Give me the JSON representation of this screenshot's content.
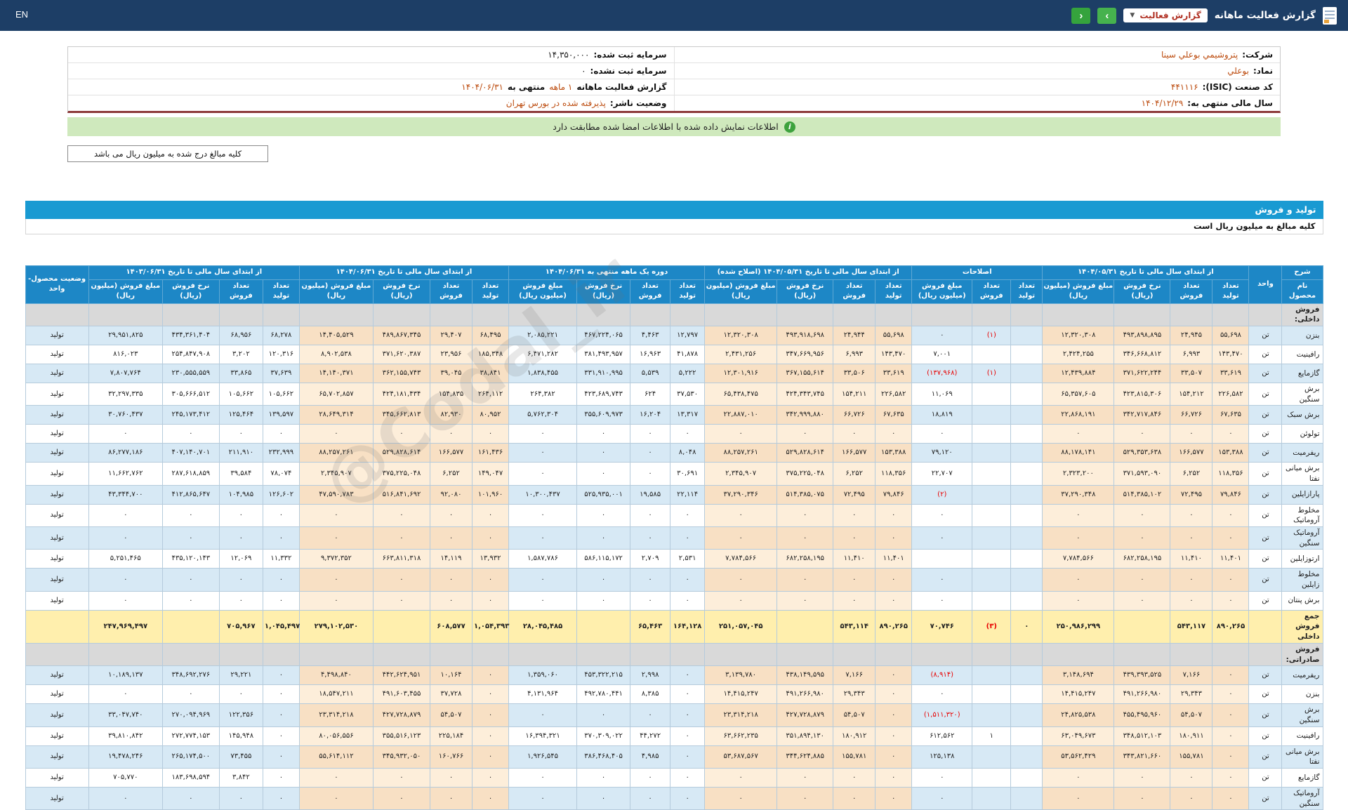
{
  "topbar": {
    "en": "EN",
    "title": "گزارش فعالیت ماهانه",
    "dropdown": "گزارش فعالیت",
    "caret": "▼",
    "next": "›",
    "prev": "‹"
  },
  "info": {
    "right": [
      {
        "label": "شرکت:",
        "value": "پتروشيمي بوعلي سينا"
      },
      {
        "label": "نماد:",
        "value": "بوعلي"
      },
      {
        "label": "کد صنعت (ISIC):",
        "value": "۴۴۱۱۱۶"
      },
      {
        "label": "سال مالی منتهی به:",
        "value": "۱۴۰۴/۱۲/۲۹"
      }
    ],
    "left": [
      {
        "label": "سرمایه ثبت شده:",
        "value": "۱۴,۳۵۰,۰۰۰"
      },
      {
        "label": "سرمایه ثبت نشده:",
        "value": "۰"
      },
      {
        "label": "گزارش فعالیت ماهانه",
        "mid": "۱ ماهه",
        "tail": "منتهی به",
        "value": "۱۴۰۴/۰۶/۳۱"
      },
      {
        "label": "وضعیت ناشر:",
        "value": "پذیرفته شده در بورس تهران"
      }
    ]
  },
  "banner": {
    "icon": "i",
    "text": "اطلاعات نمایش داده شده با اطلاعات امضا شده مطابقت دارد"
  },
  "note_box": "کلیه مبالغ درج شده به میلیون ریال می باشد",
  "section": {
    "title": "تولید و فروش",
    "subtitle": "کلیه مبالغ به میلیون ریال است"
  },
  "watermark": "@Codal_ir",
  "table": {
    "headers": {
      "desc": "شرح",
      "product": "نام محصول",
      "unit": "واحد",
      "status": "وضعیت محصول-واحد"
    },
    "groups": [
      {
        "key": "g1",
        "cream": true,
        "label": "از ابتدای سال مالی تا تاریخ ۱۴۰۴/۰۵/۳۱",
        "cols": [
          "تعداد تولید",
          "تعداد فروش",
          "نرخ فروش (ریال)",
          "مبلغ فروش (میلیون ریال)"
        ]
      },
      {
        "key": "g2",
        "cream": false,
        "label": "اصلاحات",
        "cols": [
          "تعداد تولید",
          "تعداد فروش",
          "مبلغ فروش (میلیون ریال)"
        ]
      },
      {
        "key": "g3",
        "cream": true,
        "label": "از ابتدای سال مالی تا تاریخ ۱۴۰۴/۰۵/۳۱ (اصلاح شده)",
        "cols": [
          "تعداد تولید",
          "تعداد فروش",
          "نرخ فروش (ریال)",
          "مبلغ فروش (میلیون ریال)"
        ]
      },
      {
        "key": "g4",
        "cream": false,
        "label": "دوره یک ماهه منتهی به ۱۴۰۴/۰۶/۳۱",
        "cols": [
          "تعداد تولید",
          "تعداد فروش",
          "نرخ فروش (ریال)",
          "مبلغ فروش (میلیون ریال)"
        ]
      },
      {
        "key": "g5",
        "cream": true,
        "label": "از ابتدای سال مالی تا تاریخ ۱۴۰۴/۰۶/۳۱",
        "cols": [
          "تعداد تولید",
          "تعداد فروش",
          "نرخ فروش (ریال)",
          "مبلغ فروش (میلیون ریال)"
        ]
      },
      {
        "key": "g6",
        "cream": false,
        "label": "از ابتدای سال مالی تا تاریخ ۱۴۰۳/۰۶/۳۱",
        "cols": [
          "تعداد تولید",
          "تعداد فروش",
          "نرخ فروش (ریال)",
          "مبلغ فروش (میلیون ریال)"
        ]
      }
    ],
    "rows": [
      {
        "type": "section",
        "name": "فروش داخلی:"
      },
      {
        "type": "data",
        "name": "بنزن",
        "unit": "تن",
        "status": "تولید",
        "g1": [
          "۵۵,۶۹۸",
          "۲۴,۹۴۵",
          "۴۹۳,۸۹۸,۸۹۵",
          "۱۲,۳۲۰,۳۰۸"
        ],
        "g2": [
          "",
          "(۱)",
          "۰"
        ],
        "g3": [
          "۵۵,۶۹۸",
          "۲۴,۹۴۴",
          "۴۹۳,۹۱۸,۶۹۸",
          "۱۲,۳۲۰,۳۰۸"
        ],
        "g4": [
          "۱۲,۷۹۷",
          "۴,۴۶۳",
          "۴۶۷,۲۲۴,۰۶۵",
          "۲,۰۸۵,۲۲۱"
        ],
        "g5": [
          "۶۸,۴۹۵",
          "۲۹,۴۰۷",
          "۴۸۹,۸۶۷,۳۴۵",
          "۱۴,۴۰۵,۵۲۹"
        ],
        "g6": [
          "۶۸,۲۷۸",
          "۶۸,۹۵۶",
          "۴۳۴,۳۶۱,۴۰۴",
          "۲۹,۹۵۱,۸۲۵"
        ]
      },
      {
        "type": "data",
        "name": "رافینیت",
        "unit": "تن",
        "status": "تولید",
        "g1": [
          "۱۴۳,۴۷۰",
          "۶,۹۹۳",
          "۳۴۶,۶۶۸,۸۱۲",
          "۲,۴۲۴,۲۵۵"
        ],
        "g2": [
          "",
          "",
          "۷,۰۰۱"
        ],
        "g3": [
          "۱۴۳,۴۷۰",
          "۶,۹۹۳",
          "۳۴۷,۶۶۹,۹۵۶",
          "۲,۴۳۱,۲۵۶"
        ],
        "g4": [
          "۴۱,۸۷۸",
          "۱۶,۹۶۳",
          "۳۸۱,۴۹۳,۹۵۷",
          "۶,۴۷۱,۲۸۲"
        ],
        "g5": [
          "۱۸۵,۳۴۸",
          "۲۳,۹۵۶",
          "۳۷۱,۶۲۰,۳۸۷",
          "۸,۹۰۲,۵۳۸"
        ],
        "g6": [
          "۱۲۰,۳۱۶",
          "۳,۲۰۲",
          "۲۵۴,۸۴۷,۹۰۸",
          "۸۱۶,۰۲۳"
        ]
      },
      {
        "type": "data",
        "name": "گازمایع",
        "unit": "تن",
        "status": "تولید",
        "g1": [
          "۳۳,۶۱۹",
          "۳۳,۵۰۷",
          "۳۷۱,۶۲۲,۲۴۴",
          "۱۲,۴۳۹,۸۸۴"
        ],
        "g2": [
          "",
          "(۱)",
          "(۱۳۷,۹۶۸)"
        ],
        "g3": [
          "۳۳,۶۱۹",
          "۳۳,۵۰۶",
          "۳۶۷,۱۵۵,۶۱۴",
          "۱۲,۳۰۱,۹۱۶"
        ],
        "g4": [
          "۵,۲۲۲",
          "۵,۵۳۹",
          "۳۳۱,۹۱۰,۹۹۵",
          "۱,۸۳۸,۴۵۵"
        ],
        "g5": [
          "۳۸,۸۴۱",
          "۳۹,۰۴۵",
          "۳۶۲,۱۵۵,۷۴۳",
          "۱۴,۱۴۰,۳۷۱"
        ],
        "g6": [
          "۳۷,۶۳۹",
          "۳۳,۸۶۵",
          "۲۳۰,۵۵۵,۵۵۹",
          "۷,۸۰۷,۷۶۴"
        ]
      },
      {
        "type": "data",
        "name": "برش سنگین",
        "unit": "تن",
        "status": "تولید",
        "g1": [
          "۲۲۶,۵۸۲",
          "۱۵۴,۲۱۲",
          "۴۲۳,۸۱۵,۳۰۶",
          "۶۵,۳۵۷,۶۰۵"
        ],
        "g2": [
          "",
          "",
          "۱۱,۰۶۹"
        ],
        "g3": [
          "۲۲۶,۵۸۲",
          "۱۵۴,۲۱۱",
          "۴۲۴,۳۴۳,۷۴۵",
          "۶۵,۴۳۸,۴۷۵"
        ],
        "g4": [
          "۳۷,۵۳۰",
          "۶۲۴",
          "۴۲۳,۶۸۹,۷۴۳",
          "۲۶۴,۳۸۲"
        ],
        "g5": [
          "۲۶۴,۱۱۲",
          "۱۵۴,۸۳۵",
          "۴۲۴,۱۸۱,۴۳۴",
          "۶۵,۷۰۲,۸۵۷"
        ],
        "g6": [
          "۱۰۵,۶۶۲",
          "۱۰۵,۶۶۲",
          "۳۰۵,۶۶۶,۵۱۲",
          "۳۲,۲۹۷,۳۳۵"
        ]
      },
      {
        "type": "data",
        "name": "برش سبک",
        "unit": "تن",
        "status": "تولید",
        "g1": [
          "۶۷,۶۳۵",
          "۶۶,۷۲۶",
          "۳۴۲,۷۱۷,۸۴۶",
          "۲۲,۸۶۸,۱۹۱"
        ],
        "g2": [
          "",
          "",
          "۱۸,۸۱۹"
        ],
        "g3": [
          "۶۷,۶۳۵",
          "۶۶,۷۲۶",
          "۳۴۲,۹۹۹,۸۸۰",
          "۲۲,۸۸۷,۰۱۰"
        ],
        "g4": [
          "۱۳,۳۱۷",
          "۱۶,۲۰۴",
          "۳۵۵,۶۰۹,۹۷۳",
          "۵,۷۶۲,۳۰۴"
        ],
        "g5": [
          "۸۰,۹۵۲",
          "۸۲,۹۳۰",
          "۳۴۵,۶۶۲,۸۱۳",
          "۲۸,۶۴۹,۳۱۴"
        ],
        "g6": [
          "۱۳۹,۵۹۷",
          "۱۲۵,۴۶۴",
          "۲۴۵,۱۷۳,۴۱۲",
          "۳۰,۷۶۰,۴۳۷"
        ]
      },
      {
        "type": "data",
        "name": "تولوئن",
        "unit": "تن",
        "status": "تولید",
        "g1": [
          "۰",
          "۰",
          "۰",
          "۰"
        ],
        "g2": [
          "",
          "",
          "۰"
        ],
        "g3": [
          "۰",
          "۰",
          "۰",
          "۰"
        ],
        "g4": [
          "۰",
          "۰",
          "۰",
          "۰"
        ],
        "g5": [
          "۰",
          "۰",
          "۰",
          "۰"
        ],
        "g6": [
          "۰",
          "۰",
          "۰",
          "۰"
        ]
      },
      {
        "type": "data",
        "name": "ریفرمیت",
        "unit": "تن",
        "status": "تولید",
        "g1": [
          "۱۵۳,۳۸۸",
          "۱۶۶,۵۷۷",
          "۵۲۹,۳۵۳,۶۳۸",
          "۸۸,۱۷۸,۱۴۱"
        ],
        "g2": [
          "",
          "",
          "۷۹,۱۲۰"
        ],
        "g3": [
          "۱۵۳,۳۸۸",
          "۱۶۶,۵۷۷",
          "۵۲۹,۸۲۸,۶۱۴",
          "۸۸,۲۵۷,۲۶۱"
        ],
        "g4": [
          "۸,۰۴۸",
          "۰",
          "۰",
          "۰"
        ],
        "g5": [
          "۱۶۱,۴۳۶",
          "۱۶۶,۵۷۷",
          "۵۲۹,۸۲۸,۶۱۴",
          "۸۸,۲۵۷,۲۶۱"
        ],
        "g6": [
          "۲۳۲,۹۹۹",
          "۲۱۱,۹۱۰",
          "۴۰۷,۱۴۰,۷۰۱",
          "۸۶,۲۷۷,۱۸۶"
        ]
      },
      {
        "type": "data",
        "name": "برش میانی نفتا",
        "unit": "تن",
        "status": "تولید",
        "g1": [
          "۱۱۸,۳۵۶",
          "۶,۲۵۲",
          "۳۷۱,۵۹۳,۰۹۰",
          "۲,۳۲۳,۲۰۰"
        ],
        "g2": [
          "",
          "",
          "۲۲,۷۰۷"
        ],
        "g3": [
          "۱۱۸,۳۵۶",
          "۶,۲۵۲",
          "۳۷۵,۲۲۵,۰۴۸",
          "۲,۳۴۵,۹۰۷"
        ],
        "g4": [
          "۳۰,۶۹۱",
          "۰",
          "۰",
          "۰"
        ],
        "g5": [
          "۱۴۹,۰۴۷",
          "۶,۲۵۲",
          "۳۷۵,۲۲۵,۰۴۸",
          "۲,۳۴۵,۹۰۷"
        ],
        "g6": [
          "۷۸,۰۷۴",
          "۳۹,۵۸۴",
          "۲۸۷,۶۱۸,۸۵۹",
          "۱۱,۶۶۲,۷۶۲"
        ]
      },
      {
        "type": "data",
        "name": "پارازایلین",
        "unit": "تن",
        "status": "تولید",
        "g1": [
          "۷۹,۸۴۶",
          "۷۲,۴۹۵",
          "۵۱۴,۳۸۵,۱۰۲",
          "۳۷,۲۹۰,۳۴۸"
        ],
        "g2": [
          "",
          "",
          "(۲)"
        ],
        "g3": [
          "۷۹,۸۴۶",
          "۷۲,۴۹۵",
          "۵۱۴,۳۸۵,۰۷۵",
          "۳۷,۲۹۰,۳۴۶"
        ],
        "g4": [
          "۲۲,۱۱۴",
          "۱۹,۵۸۵",
          "۵۲۵,۹۳۵,۰۰۱",
          "۱۰,۳۰۰,۴۳۷"
        ],
        "g5": [
          "۱۰۱,۹۶۰",
          "۹۲,۰۸۰",
          "۵۱۶,۸۴۱,۶۹۲",
          "۴۷,۵۹۰,۷۸۳"
        ],
        "g6": [
          "۱۲۶,۶۰۲",
          "۱۰۴,۹۸۵",
          "۴۱۲,۸۶۵,۶۴۷",
          "۴۳,۳۴۴,۷۰۰"
        ]
      },
      {
        "type": "data",
        "name": "مخلوط آروماتیک",
        "unit": "تن",
        "status": "تولید",
        "g1": [
          "۰",
          "۰",
          "۰",
          "۰"
        ],
        "g2": [
          "",
          "",
          "۰"
        ],
        "g3": [
          "۰",
          "۰",
          "۰",
          "۰"
        ],
        "g4": [
          "۰",
          "۰",
          "۰",
          "۰"
        ],
        "g5": [
          "۰",
          "۰",
          "۰",
          "۰"
        ],
        "g6": [
          "۰",
          "۰",
          "۰",
          "۰"
        ]
      },
      {
        "type": "data",
        "name": "آروماتیک سنگین",
        "unit": "تن",
        "status": "تولید",
        "g1": [
          "۰",
          "۰",
          "۰",
          "۰"
        ],
        "g2": [
          "",
          "",
          "۰"
        ],
        "g3": [
          "۰",
          "۰",
          "۰",
          "۰"
        ],
        "g4": [
          "۰",
          "۰",
          "۰",
          "۰"
        ],
        "g5": [
          "۰",
          "۰",
          "۰",
          "۰"
        ],
        "g6": [
          "۰",
          "۰",
          "۰",
          "۰"
        ]
      },
      {
        "type": "data",
        "name": "ارتوزایلین",
        "unit": "تن",
        "status": "تولید",
        "g1": [
          "۱۱,۴۰۱",
          "۱۱,۴۱۰",
          "۶۸۲,۲۵۸,۱۹۵",
          "۷,۷۸۴,۵۶۶"
        ],
        "g2": [
          "",
          "",
          ""
        ],
        "g3": [
          "۱۱,۴۰۱",
          "۱۱,۴۱۰",
          "۶۸۲,۲۵۸,۱۹۵",
          "۷,۷۸۴,۵۶۶"
        ],
        "g4": [
          "۲,۵۳۱",
          "۲,۷۰۹",
          "۵۸۶,۱۱۵,۱۷۲",
          "۱,۵۸۷,۷۸۶"
        ],
        "g5": [
          "۱۳,۹۳۲",
          "۱۴,۱۱۹",
          "۶۶۳,۸۱۱,۳۱۸",
          "۹,۳۷۲,۳۵۲"
        ],
        "g6": [
          "۱۱,۳۳۲",
          "۱۲,۰۶۹",
          "۴۳۵,۱۲۰,۱۴۳",
          "۵,۲۵۱,۴۶۵"
        ]
      },
      {
        "type": "data",
        "name": "مخلوط زایلین",
        "unit": "تن",
        "status": "تولید",
        "g1": [
          "۰",
          "۰",
          "۰",
          "۰"
        ],
        "g2": [
          "",
          "",
          "۰"
        ],
        "g3": [
          "۰",
          "۰",
          "۰",
          "۰"
        ],
        "g4": [
          "۰",
          "۰",
          "۰",
          "۰"
        ],
        "g5": [
          "۰",
          "۰",
          "۰",
          "۰"
        ],
        "g6": [
          "۰",
          "۰",
          "۰",
          "۰"
        ]
      },
      {
        "type": "data",
        "name": "برش پنتان",
        "unit": "تن",
        "status": "تولید",
        "g1": [
          "۰",
          "۰",
          "۰",
          "۰"
        ],
        "g2": [
          "",
          "",
          "۰"
        ],
        "g3": [
          "۰",
          "۰",
          "۰",
          "۰"
        ],
        "g4": [
          "۰",
          "۰",
          "۰",
          "۰"
        ],
        "g5": [
          "۰",
          "۰",
          "۰",
          "۰"
        ],
        "g6": [
          "۰",
          "۰",
          "۰",
          "۰"
        ]
      },
      {
        "type": "total",
        "name": "جمع فروش داخلی",
        "unit": "",
        "status": "",
        "g1": [
          "۸۹۰,۲۶۵",
          "۵۴۳,۱۱۷",
          "",
          "۲۵۰,۹۸۶,۲۹۹"
        ],
        "g2": [
          "۰",
          "(۳)",
          "۷۰,۷۴۶"
        ],
        "g3": [
          "۸۹۰,۲۶۵",
          "۵۴۳,۱۱۴",
          "",
          "۲۵۱,۰۵۷,۰۴۵"
        ],
        "g4": [
          "۱۶۴,۱۲۸",
          "۶۵,۴۶۳",
          "",
          "۲۸,۰۴۵,۴۸۵"
        ],
        "g5": [
          "۱,۰۵۴,۳۹۳",
          "۶۰۸,۵۷۷",
          "",
          "۲۷۹,۱۰۲,۵۳۰"
        ],
        "g6": [
          "۱,۰۴۵,۴۹۷",
          "۷۰۵,۹۶۷",
          "",
          "۲۴۷,۹۶۹,۴۹۷"
        ]
      },
      {
        "type": "section",
        "name": "فروش صادراتی:"
      },
      {
        "type": "data",
        "name": "ریفرمیت",
        "unit": "تن",
        "status": "تولید",
        "g1": [
          "۰",
          "۷,۱۶۶",
          "۴۳۹,۳۹۳,۵۲۵",
          "۳,۱۴۸,۶۹۴"
        ],
        "g2": [
          "",
          "",
          "(۸,۹۱۴)"
        ],
        "g3": [
          "۰",
          "۷,۱۶۶",
          "۴۳۸,۱۴۹,۵۹۵",
          "۳,۱۳۹,۷۸۰"
        ],
        "g4": [
          "۰",
          "۲,۹۹۸",
          "۴۵۳,۳۲۲,۲۱۵",
          "۱,۳۵۹,۰۶۰"
        ],
        "g5": [
          "۰",
          "۱۰,۱۶۴",
          "۴۴۲,۶۲۴,۹۵۱",
          "۴,۴۹۸,۸۴۰"
        ],
        "g6": [
          "۰",
          "۲۹,۲۲۱",
          "۳۴۸,۶۹۲,۲۷۶",
          "۱۰,۱۸۹,۱۳۷"
        ]
      },
      {
        "type": "data",
        "name": "بنزن",
        "unit": "تن",
        "status": "تولید",
        "g1": [
          "۰",
          "۲۹,۳۴۳",
          "۴۹۱,۲۶۶,۹۸۰",
          "۱۴,۴۱۵,۲۴۷"
        ],
        "g2": [
          "",
          "",
          "۰"
        ],
        "g3": [
          "۰",
          "۲۹,۳۴۳",
          "۴۹۱,۲۶۶,۹۸۰",
          "۱۴,۴۱۵,۲۴۷"
        ],
        "g4": [
          "۰",
          "۸,۳۸۵",
          "۴۹۲,۷۸۰,۴۴۱",
          "۴,۱۳۱,۹۶۴"
        ],
        "g5": [
          "۰",
          "۳۷,۷۲۸",
          "۴۹۱,۶۰۳,۴۵۵",
          "۱۸,۵۴۷,۲۱۱"
        ],
        "g6": [
          "۰",
          "۰",
          "۰",
          "۰"
        ]
      },
      {
        "type": "data",
        "name": "برش سنگین",
        "unit": "تن",
        "status": "تولید",
        "g1": [
          "۰",
          "۵۴,۵۰۷",
          "۴۵۵,۴۹۵,۹۶۰",
          "۲۴,۸۲۵,۵۳۸"
        ],
        "g2": [
          "",
          "",
          "(۱,۵۱۱,۳۲۰)"
        ],
        "g3": [
          "۰",
          "۵۴,۵۰۷",
          "۴۲۷,۷۲۸,۸۷۹",
          "۲۳,۳۱۴,۲۱۸"
        ],
        "g4": [
          "۰",
          "۰",
          "۰",
          "۰"
        ],
        "g5": [
          "۰",
          "۵۴,۵۰۷",
          "۴۲۷,۷۲۸,۸۷۹",
          "۲۳,۳۱۴,۲۱۸"
        ],
        "g6": [
          "۰",
          "۱۲۲,۳۵۶",
          "۲۷۰,۰۹۴,۹۶۹",
          "۳۳,۰۴۷,۷۴۰"
        ]
      },
      {
        "type": "data",
        "name": "رافینیت",
        "unit": "تن",
        "status": "تولید",
        "g1": [
          "۰",
          "۱۸۰,۹۱۱",
          "۳۴۸,۵۱۲,۱۰۳",
          "۶۳,۰۴۹,۶۷۳"
        ],
        "g2": [
          "",
          "۱",
          "۶۱۲,۵۶۲"
        ],
        "g3": [
          "۰",
          "۱۸۰,۹۱۲",
          "۳۵۱,۸۹۴,۱۳۰",
          "۶۳,۶۶۲,۲۳۵"
        ],
        "g4": [
          "۰",
          "۴۴,۲۷۲",
          "۳۷۰,۳۰۹,۰۲۲",
          "۱۶,۳۹۴,۳۲۱"
        ],
        "g5": [
          "۰",
          "۲۲۵,۱۸۴",
          "۳۵۵,۵۱۶,۱۲۳",
          "۸۰,۰۵۶,۵۵۶"
        ],
        "g6": [
          "۰",
          "۱۴۵,۹۴۸",
          "۲۷۲,۷۷۴,۱۵۳",
          "۳۹,۸۱۰,۸۴۲"
        ]
      },
      {
        "type": "data",
        "name": "برش میانی نفتا",
        "unit": "تن",
        "status": "تولید",
        "g1": [
          "۰",
          "۱۵۵,۷۸۱",
          "۳۴۳,۸۲۱,۶۶۰",
          "۵۳,۵۶۲,۴۲۹"
        ],
        "g2": [
          "",
          "",
          "۱۲۵,۱۳۸"
        ],
        "g3": [
          "۰",
          "۱۵۵,۷۸۱",
          "۳۴۴,۶۲۴,۸۸۵",
          "۵۳,۶۸۷,۵۶۷"
        ],
        "g4": [
          "۰",
          "۴,۹۸۵",
          "۳۸۶,۴۶۸,۴۰۵",
          "۱,۹۲۶,۵۴۵"
        ],
        "g5": [
          "۰",
          "۱۶۰,۷۶۶",
          "۳۴۵,۹۳۲,۰۵۰",
          "۵۵,۶۱۴,۱۱۲"
        ],
        "g6": [
          "۰",
          "۷۳,۴۵۵",
          "۲۶۵,۱۷۴,۵۰۰",
          "۱۹,۴۷۸,۲۴۶"
        ]
      },
      {
        "type": "data",
        "name": "گازمایع",
        "unit": "تن",
        "status": "تولید",
        "g1": [
          "۰",
          "۰",
          "۰",
          "۰"
        ],
        "g2": [
          "",
          "",
          "۰"
        ],
        "g3": [
          "۰",
          "۰",
          "۰",
          "۰"
        ],
        "g4": [
          "۰",
          "۰",
          "۰",
          "۰"
        ],
        "g5": [
          "۰",
          "۰",
          "۰",
          "۰"
        ],
        "g6": [
          "۰",
          "۳,۸۴۲",
          "۱۸۳,۶۹۸,۵۹۴",
          "۷۰۵,۷۷۰"
        ]
      },
      {
        "type": "data",
        "name": "آروماتیک سنگین",
        "unit": "تن",
        "status": "تولید",
        "g1": [
          "۰",
          "۰",
          "۰",
          "۰"
        ],
        "g2": [
          "",
          "",
          "۰"
        ],
        "g3": [
          "۰",
          "۰",
          "۰",
          "۰"
        ],
        "g4": [
          "۰",
          "۰",
          "۰",
          "۰"
        ],
        "g5": [
          "۰",
          "۰",
          "۰",
          "۰"
        ],
        "g6": [
          "۰",
          "۰",
          "۰",
          "۰"
        ]
      }
    ]
  }
}
